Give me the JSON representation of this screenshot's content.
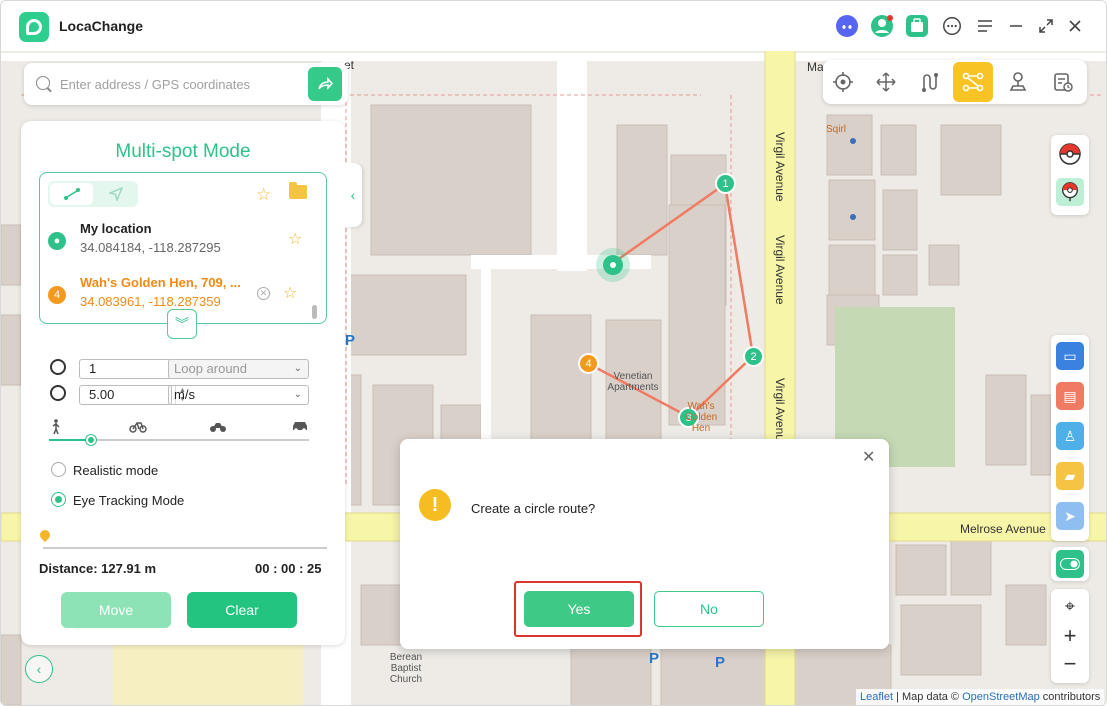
{
  "app": {
    "title": "LocaChange"
  },
  "titlebar_icons": [
    "discord-icon",
    "avatar-icon",
    "toolbox-icon",
    "chat-icon",
    "menu-icon",
    "minimize-icon",
    "fullscreen-icon",
    "close-icon"
  ],
  "search": {
    "placeholder": "Enter address / GPS coordinates",
    "value": ""
  },
  "modes": [
    {
      "name": "teleport",
      "icon": "crosshair-icon",
      "active": false
    },
    {
      "name": "jump",
      "icon": "move-icon",
      "active": false
    },
    {
      "name": "two-spot",
      "icon": "route-icon",
      "active": false
    },
    {
      "name": "multi-spot",
      "icon": "multi-spot-icon",
      "active": true
    },
    {
      "name": "joystick",
      "icon": "joystick-icon",
      "active": false
    },
    {
      "name": "history",
      "icon": "history-icon",
      "active": false
    }
  ],
  "panel": {
    "title": "Multi-spot Mode",
    "spots": [
      {
        "name": "My location",
        "coords": "34.084184, -118.287295"
      },
      {
        "index": "4",
        "name": "Wah's Golden Hen, 709, ...",
        "coords": "34.083961, -118.287359"
      }
    ],
    "times": "1",
    "loop_mode": "Loop around",
    "speed": "5.00",
    "speed_unit": "m/s",
    "speed_level": 0.16,
    "realistic_label": "Realistic mode",
    "eye_tracking_label": "Eye Tracking Mode",
    "distance": "Distance: 127.91 m",
    "timer": "00 : 00 : 25",
    "move_label": "Move",
    "clear_label": "Clear"
  },
  "map": {
    "streets": [
      "Virgil Avenue",
      "Virgil Avenue",
      "Virgil Avenue",
      "Melrose Avenue",
      "et",
      "Ma"
    ],
    "pois": [
      "Sqirl",
      "Venetian Apartments",
      "Wah's Golden Hen",
      "Berean Baptist Church"
    ],
    "waypoints": [
      "1",
      "2",
      "3",
      "4"
    ],
    "attribution": {
      "leaflet": "Leaflet",
      "sep": " | Map data © ",
      "osm": "OpenStreetMap",
      "tail": " contributors"
    }
  },
  "dialog": {
    "message": "Create a circle route?",
    "yes_label": "Yes",
    "no_label": "No"
  },
  "colors": {
    "accent": "#2ec28a",
    "mode_active": "#f7c325",
    "route_line": "#f07a62",
    "warning": "#f5bd22",
    "highlight": "#d9372b"
  }
}
